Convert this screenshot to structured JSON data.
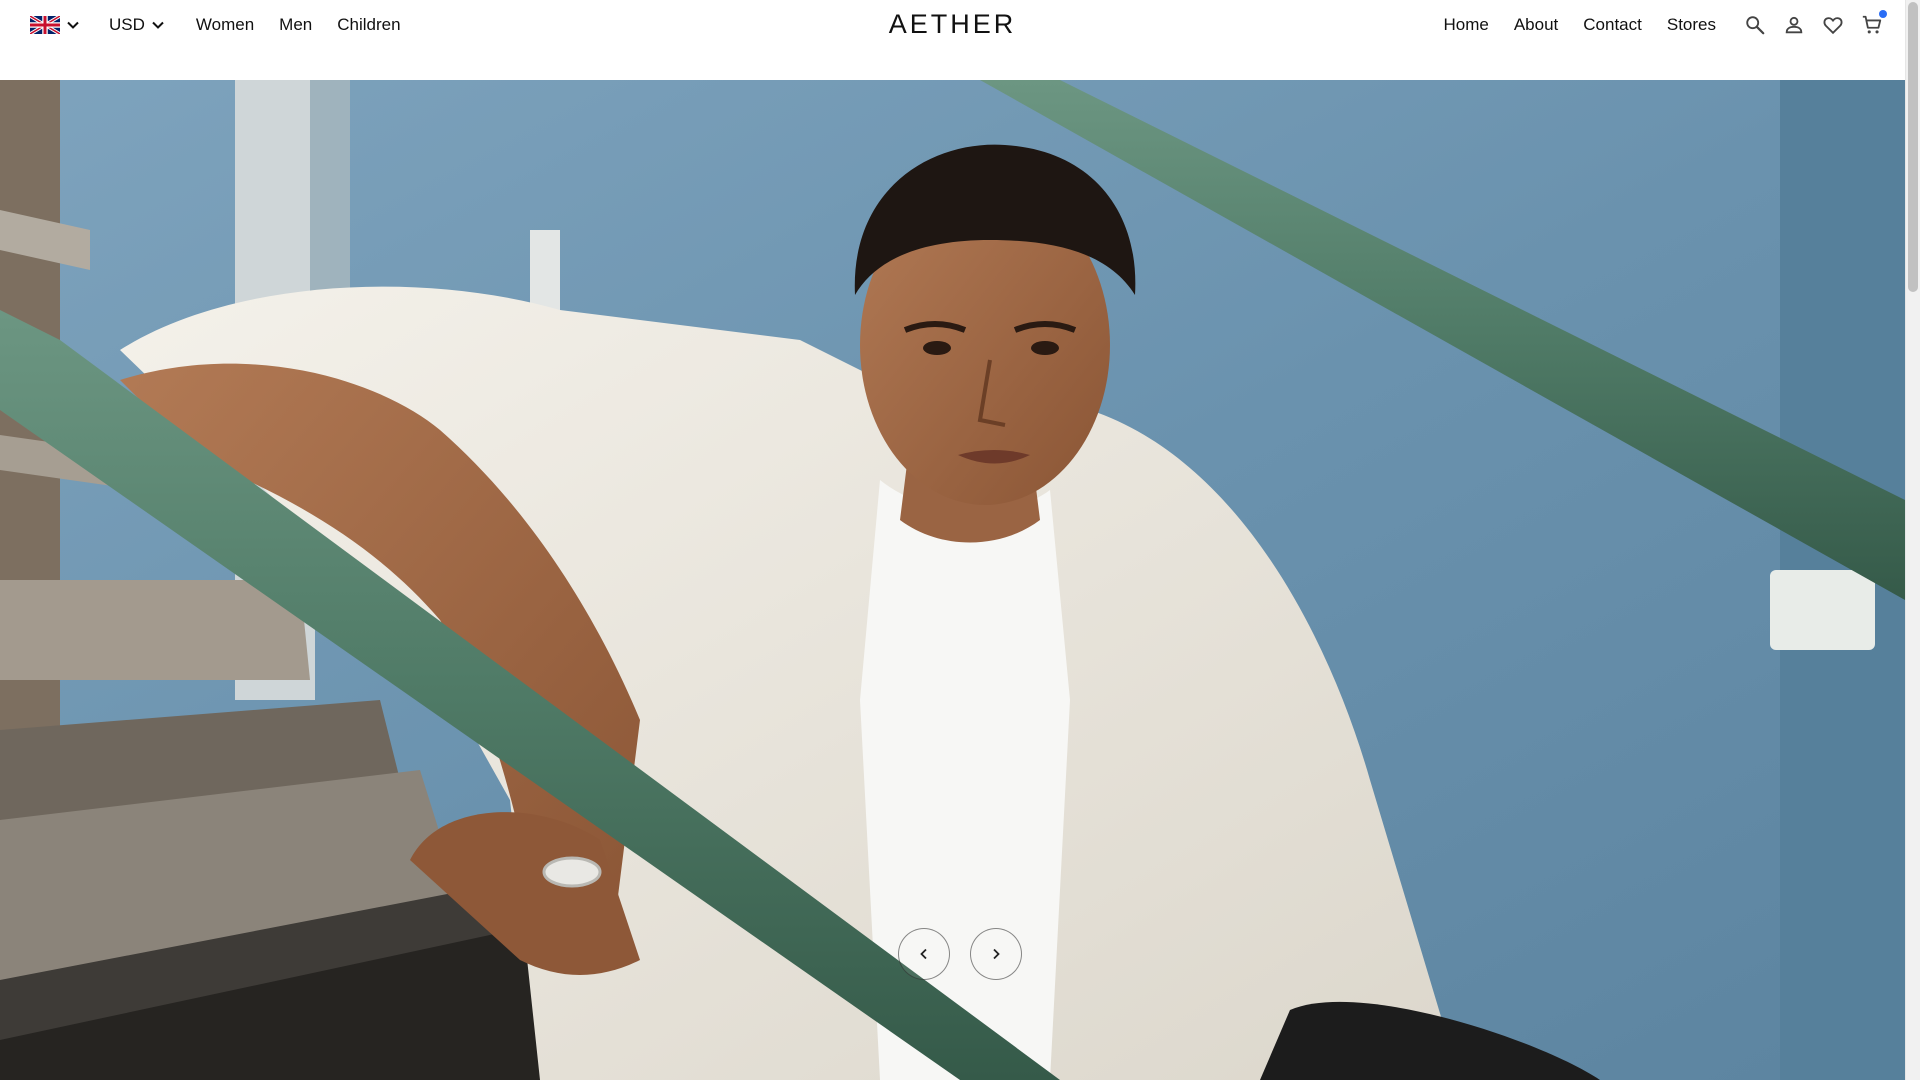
{
  "header": {
    "language": {
      "flag": "uk-flag-icon"
    },
    "currency": {
      "label": "USD"
    },
    "left_nav": [
      {
        "label": "Women"
      },
      {
        "label": "Men"
      },
      {
        "label": "Children"
      }
    ],
    "logo": "AETHER",
    "right_nav": [
      {
        "label": "Home"
      },
      {
        "label": "About"
      },
      {
        "label": "Contact"
      },
      {
        "label": "Stores"
      }
    ],
    "icons": [
      "search-icon",
      "account-icon",
      "wishlist-icon",
      "cart-icon"
    ]
  },
  "hero": {
    "image": "model-in-white-shirt-on-green-stair-railing",
    "controls": {
      "prev": "chevron-left-icon",
      "next": "chevron-right-icon"
    }
  },
  "colors": {
    "accent_cart_badge": "#2a6df5",
    "hero_wall": "#6b93ae",
    "railing": "#4f7a66"
  }
}
